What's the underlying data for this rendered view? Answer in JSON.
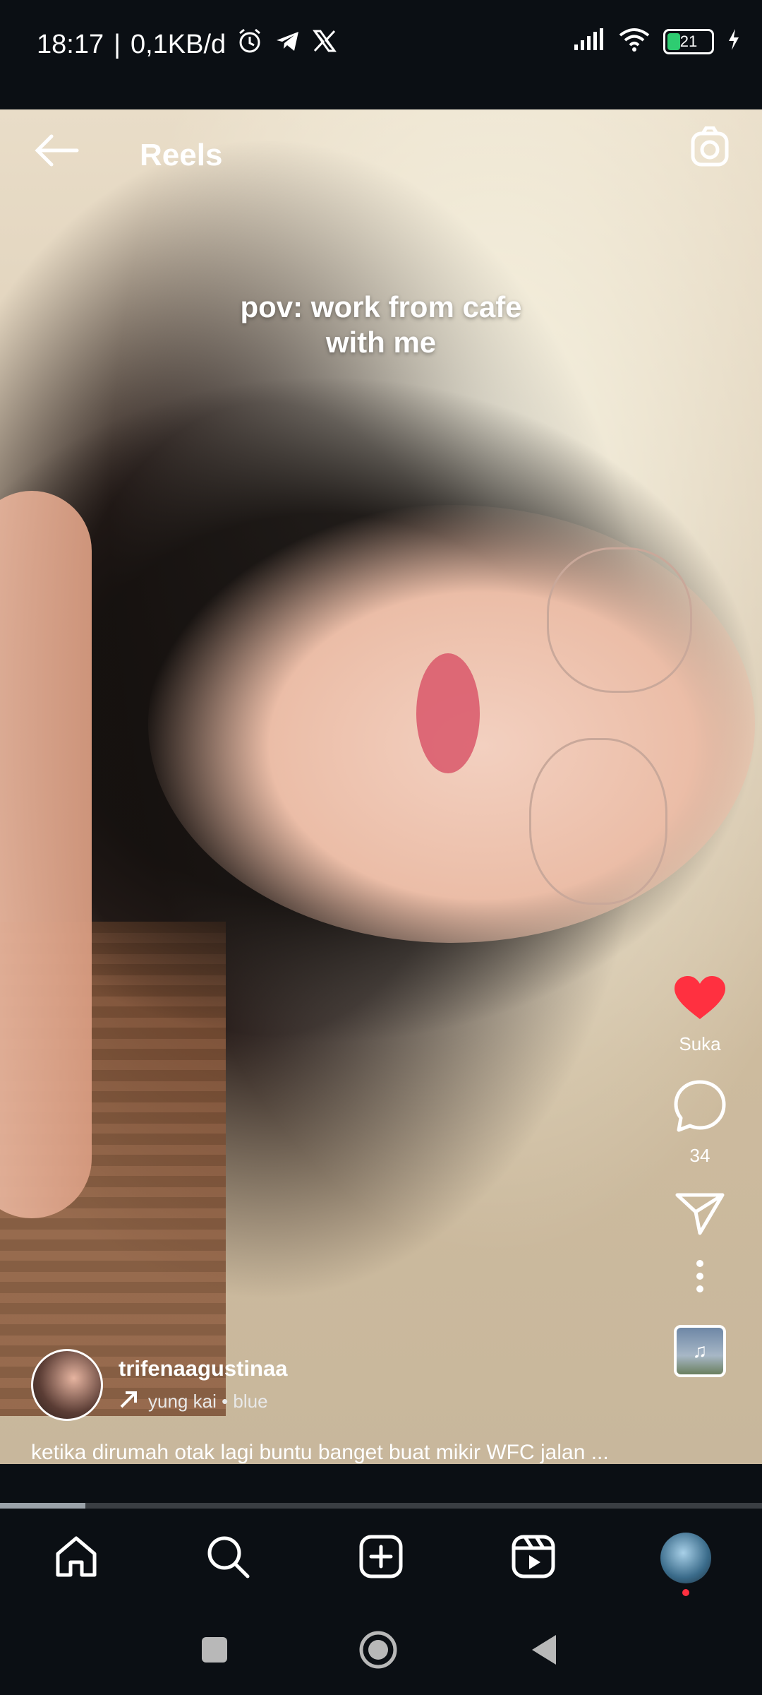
{
  "status": {
    "time": "18:17",
    "net_speed": "0,1KB/d",
    "battery_level": "21"
  },
  "header": {
    "title": "Reels"
  },
  "overlay": {
    "line1": "pov: work from cafe",
    "line2": "with me"
  },
  "actions": {
    "like_label": "Suka",
    "comment_count": "34"
  },
  "author": {
    "username": "trifenaagustinaa",
    "audio": "yung kai • blue"
  },
  "caption": "ketika dirumah otak lagi buntu banget buat mikir WFC jalan ...",
  "colors": {
    "like": "#ff3040",
    "background": "#0b0f14"
  },
  "icons": [
    "back-arrow-icon",
    "camera-icon",
    "heart-icon",
    "comment-icon",
    "share-icon",
    "more-icon",
    "music-icon",
    "home-icon",
    "search-icon",
    "create-icon",
    "reels-icon"
  ]
}
